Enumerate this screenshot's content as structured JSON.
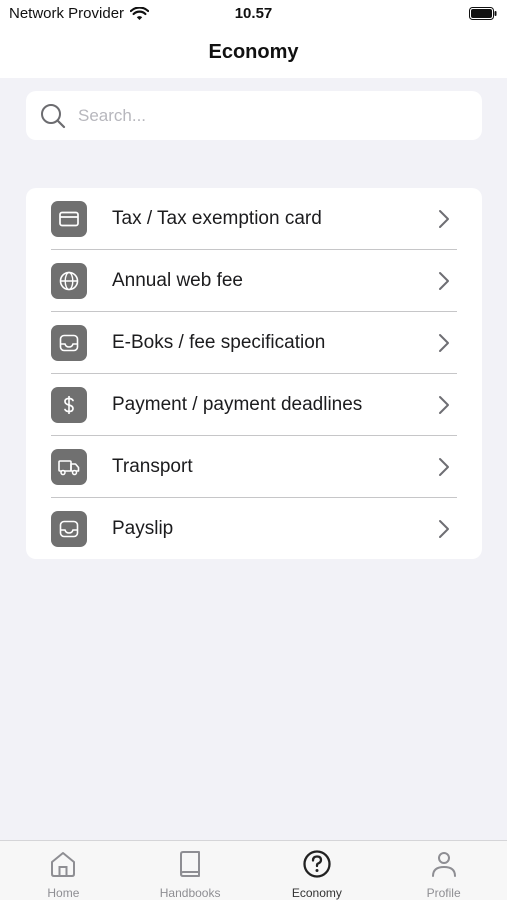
{
  "status_bar": {
    "carrier": "Network Provider",
    "time": "10.57"
  },
  "header": {
    "title": "Economy"
  },
  "search": {
    "placeholder": "Search...",
    "value": ""
  },
  "menu": {
    "items": [
      {
        "label": "Tax / Tax exemption card",
        "icon": "credit-card-icon"
      },
      {
        "label": "Annual web fee",
        "icon": "globe-icon"
      },
      {
        "label": "E-Boks / fee specification",
        "icon": "inbox-icon"
      },
      {
        "label": "Payment / payment deadlines",
        "icon": "dollar-icon"
      },
      {
        "label": "Transport",
        "icon": "truck-icon"
      },
      {
        "label": "Payslip",
        "icon": "inbox-icon"
      }
    ]
  },
  "tab_bar": {
    "tabs": [
      {
        "label": "Home",
        "icon": "home-icon",
        "active": false
      },
      {
        "label": "Handbooks",
        "icon": "book-icon",
        "active": false
      },
      {
        "label": "Economy",
        "icon": "question-circle-icon",
        "active": true
      },
      {
        "label": "Profile",
        "icon": "person-icon",
        "active": false
      }
    ]
  },
  "colors": {
    "background": "#f2f2f7",
    "icon_tile": "#707070",
    "tab_inactive": "#8e8e93",
    "tab_active": "#333333"
  }
}
